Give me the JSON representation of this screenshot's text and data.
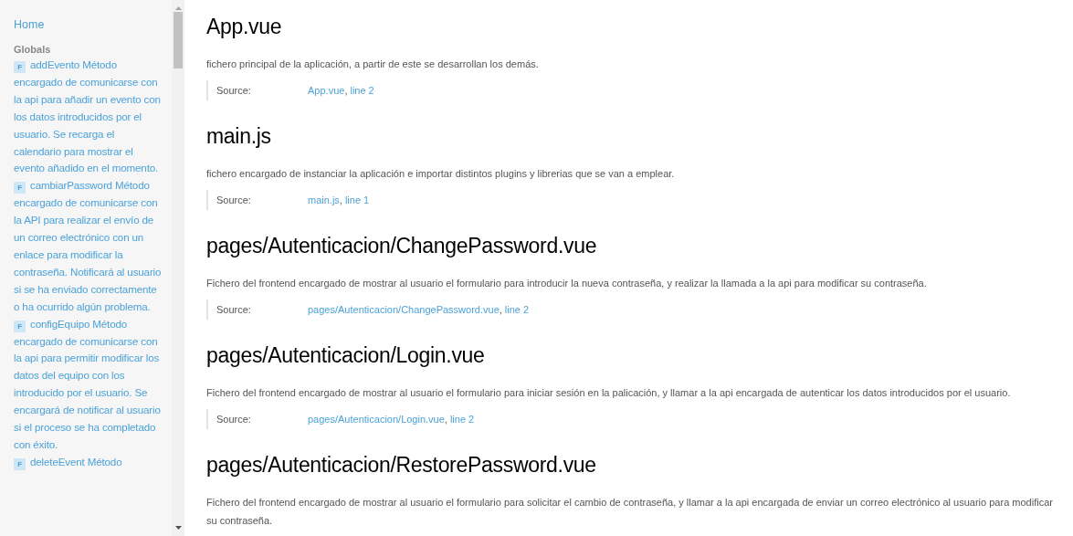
{
  "sidebar": {
    "home": "Home",
    "section_title": "Globals",
    "items": [
      {
        "badge": "F",
        "text": "addEvento Método encargado de comunicarse con la api para añadir un evento con los datos introducidos por el usuario. Se recarga el calendario para mostrar el evento añadido en el momento."
      },
      {
        "badge": "F",
        "text": "cambiarPassword Método encargado de comunicarse con la API para realizar el envío de un correo electrónico con un enlace para modificar la contraseña. Notificará al usuario si se ha enviado correctamente o ha ocurrido algún problema."
      },
      {
        "badge": "F",
        "text": "configEquipo Método encargado de comunicarse con la api para permitir modificar los datos del equipo con los introducido por el usuario. Se encargará de notificar al usuario si el proceso se ha completado con éxito."
      },
      {
        "badge": "F",
        "text": "deleteEvent Método"
      }
    ]
  },
  "sections": [
    {
      "title": "App.vue",
      "description": "fichero principal de la aplicación, a partir de este se desarrollan los demás.",
      "source_label": "Source:",
      "file": "App.vue",
      "separator": ",",
      "line": "line 2"
    },
    {
      "title": "main.js",
      "description": "fichero encargado de instanciar la aplicación e importar distintos plugins y librerias que se van a emplear.",
      "source_label": "Source:",
      "file": "main.js",
      "separator": ",",
      "line": "line 1"
    },
    {
      "title": "pages/Autenticacion/ChangePassword.vue",
      "description": "Fichero del frontend encargado de mostrar al usuario el formulario para introducir la nueva contraseña, y realizar la llamada a la api para modificar su contraseña.",
      "source_label": "Source:",
      "file": "pages/Autenticacion/ChangePassword.vue",
      "separator": ",",
      "line": "line 2"
    },
    {
      "title": "pages/Autenticacion/Login.vue",
      "description": "Fichero del frontend encargado de mostrar al usuario el formulario para iniciar sesión en la palicación, y llamar a la api encargada de autenticar los datos introducidos por el usuario.",
      "source_label": "Source:",
      "file": "pages/Autenticacion/Login.vue",
      "separator": ",",
      "line": "line 2"
    },
    {
      "title": "pages/Autenticacion/RestorePassword.vue",
      "description": "Fichero del frontend encargado de mostrar al usuario el formulario para solicitar el cambio de contraseña, y llamar a la api encargada de enviar un correo electrónico al usuario para modificar su contraseña."
    }
  ]
}
